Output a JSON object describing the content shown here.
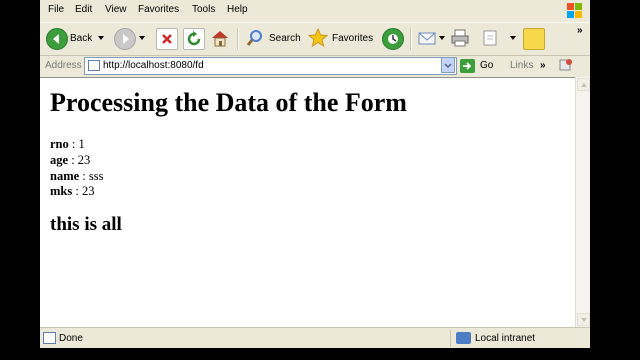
{
  "menu": {
    "items": [
      "File",
      "Edit",
      "View",
      "Favorites",
      "Tools",
      "Help"
    ]
  },
  "toolbar": {
    "back_label": "Back",
    "search_label": "Search",
    "favorites_label": "Favorites"
  },
  "address": {
    "label": "Address",
    "url": "http://localhost:8080/fd",
    "go_label": "Go",
    "links_label": "Links"
  },
  "page": {
    "title": "Processing the Data of the Form",
    "fields": [
      {
        "key": "rno",
        "value": "1"
      },
      {
        "key": "age",
        "value": "23"
      },
      {
        "key": "name",
        "value": "sss"
      },
      {
        "key": "mks",
        "value": "23"
      }
    ],
    "footer": "this is all"
  },
  "status": {
    "text": "Done",
    "zone": "Local intranet"
  },
  "colors": {
    "chrome": "#ECE9D8",
    "content_bg": "#FFFFFF",
    "accent_blue": "#4E7DC8",
    "back_green": "#3C9E3C"
  }
}
